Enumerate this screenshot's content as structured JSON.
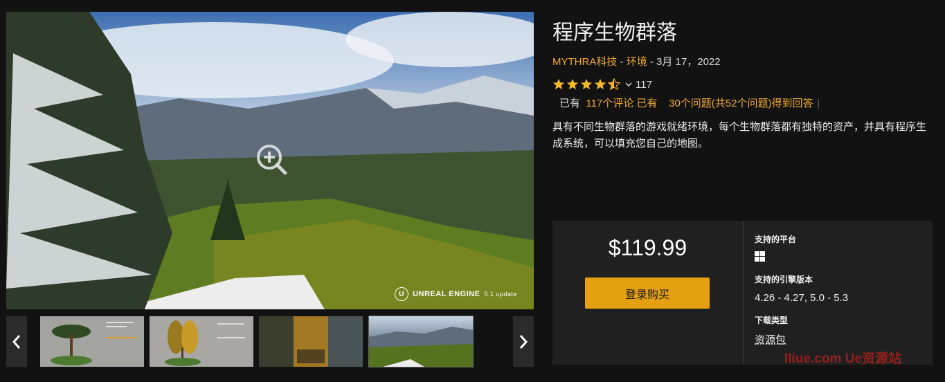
{
  "product": {
    "title": "程序生物群落",
    "seller": "MYTHRA科技",
    "sep1": " - ",
    "category": "环境",
    "date_text": " - 3月 17，2022",
    "rating_count": "117",
    "rating_value": 4.5,
    "reviews_prefix": "已有",
    "reviews_link": "117个评论 已有",
    "questions_link": "30个问题(共52个问题)得到回答",
    "reviews_sep": "|",
    "description": "具有不同生物群落的游戏就绪环境，每个生物群落都有独特的资产，并具有程序生成系统，可以填充您自己的地图。"
  },
  "purchase": {
    "price": "$119.99",
    "buy_label": "登录购买",
    "platforms_label": "支持的平台",
    "platform_icons": [
      "windows-icon"
    ],
    "engine_label": "支持的引擎版本",
    "engine_versions": "4.26 - 4.27, 5.0 - 5.3",
    "download_label": "下载类型",
    "download_value": "资源包"
  },
  "gallery": {
    "badge_text": "UNREAL ENGINE",
    "badge_version": "5.1 update",
    "badge_logo": "U",
    "thumbnails": [
      "thumb-1",
      "thumb-2",
      "thumb-3",
      "thumb-4"
    ]
  },
  "watermark": "lliue.com   Ue资源站",
  "colors": {
    "accent": "#f0a830",
    "button": "#e5a011",
    "background": "#121212",
    "panel": "#202020"
  }
}
